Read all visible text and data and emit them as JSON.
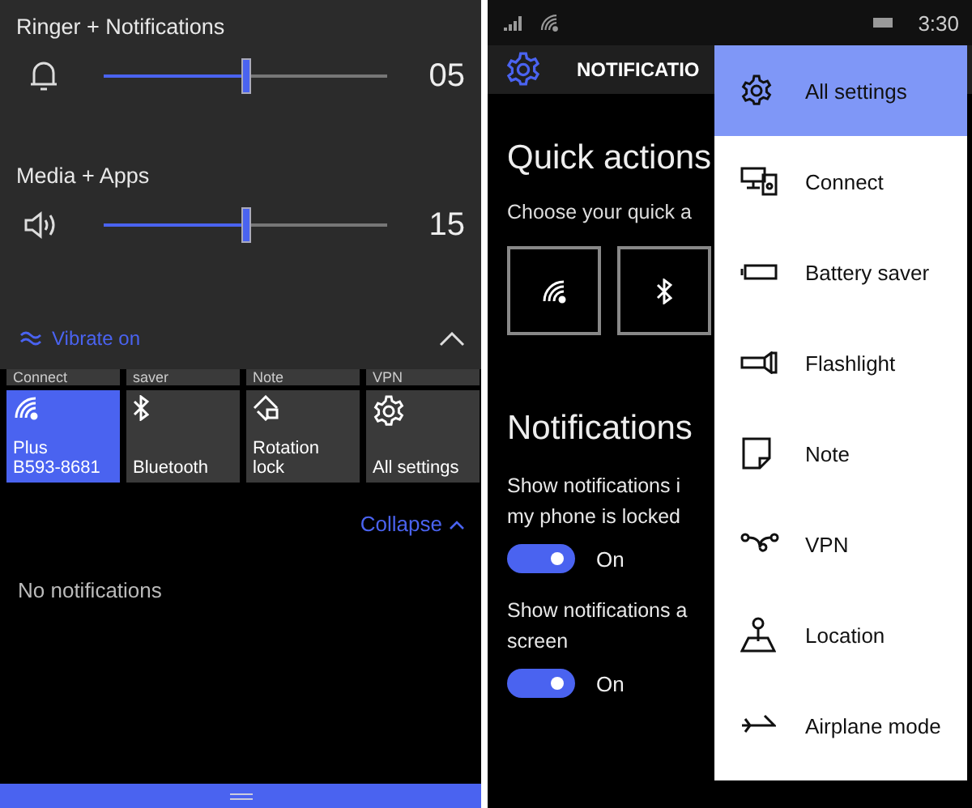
{
  "volume_panel": {
    "sliders": [
      {
        "label": "Ringer + Notifications",
        "level": 0.5,
        "reading": "05"
      },
      {
        "label": "Media + Apps",
        "level": 0.5,
        "reading": "15"
      }
    ],
    "vibrate": {
      "label": "Vibrate on",
      "on": true
    }
  },
  "action_center": {
    "cut_tiles": [
      "Connect",
      "saver",
      "Note",
      "VPN"
    ],
    "tiles": [
      {
        "lines": [
          "Plus",
          "B593-8681"
        ],
        "on": true
      },
      {
        "lines": [
          "Bluetooth"
        ],
        "on": false
      },
      {
        "lines": [
          "Rotation",
          "lock"
        ],
        "on": false
      },
      {
        "lines": [
          "All settings"
        ],
        "on": false
      }
    ],
    "collapse": "Collapse",
    "empty_text": "No notifications"
  },
  "status_bar": {
    "time": "3:30"
  },
  "settings": {
    "title": "NOTIFICATIO",
    "quick_title": "Quick actions",
    "quick_hint": "Choose your quick a",
    "notifications_title": "Notifications",
    "options": [
      {
        "lines": [
          "Show notifications i",
          "my phone is locked"
        ],
        "on": true,
        "state": "On"
      },
      {
        "lines": [
          "Show notifications a",
          "screen"
        ],
        "on": true,
        "state": "On"
      }
    ]
  },
  "menu": {
    "items": [
      {
        "label": "All settings",
        "selected": true
      },
      {
        "label": "Connect",
        "selected": false
      },
      {
        "label": "Battery saver",
        "selected": false
      },
      {
        "label": "Flashlight",
        "selected": false
      },
      {
        "label": "Note",
        "selected": false
      },
      {
        "label": "VPN",
        "selected": false
      },
      {
        "label": "Location",
        "selected": false
      },
      {
        "label": "Airplane mode",
        "selected": false
      }
    ]
  }
}
